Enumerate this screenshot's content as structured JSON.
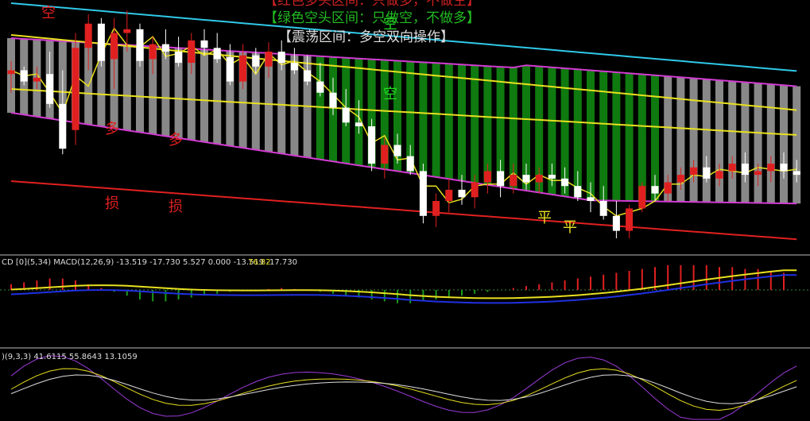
{
  "banner": {
    "red": "【红色多头区间：只做多，不做空】",
    "green": "【绿色空头区间：只做空，不做多】",
    "gray": "【震荡区间：多空双向操作】"
  },
  "signals": {
    "kong": "空",
    "duo": "多",
    "sun": "损",
    "ping": "平"
  },
  "macd_header": {
    "label": "CD [0](5,34)  MACD(12,26,9) -13.519 -17.730 5.527 0.000 -13.519 -17.730",
    "extra": "76.82"
  },
  "kdj_header": {
    "label": ")(9,3,3) 41.6115 55.8643 13.1059"
  },
  "colors": {
    "bull_band": "#888888",
    "bear_band": "#0f7a0f",
    "envelope": "#d23cd2",
    "ma_yellow": "#e8e020",
    "ma_cyan": "#30c8e8",
    "long_red": "#e02020",
    "candle_up": "#e02020",
    "candle_down": "#ffffff",
    "macd_up": "#e02020",
    "macd_down": "#1a9a1a"
  },
  "chart_data": {
    "type": "candlestick",
    "candles": [
      [
        88,
        95,
        78,
        90
      ],
      [
        90,
        92,
        82,
        84
      ],
      [
        84,
        92,
        80,
        86
      ],
      [
        88,
        100,
        70,
        72
      ],
      [
        72,
        90,
        45,
        48
      ],
      [
        58,
        110,
        50,
        102
      ],
      [
        102,
        120,
        90,
        115
      ],
      [
        115,
        118,
        92,
        95
      ],
      [
        96,
        118,
        80,
        110
      ],
      [
        110,
        122,
        100,
        112
      ],
      [
        112,
        115,
        92,
        95
      ],
      [
        96,
        108,
        88,
        104
      ],
      [
        104,
        112,
        96,
        100
      ],
      [
        100,
        108,
        92,
        94
      ],
      [
        94,
        110,
        88,
        106
      ],
      [
        106,
        112,
        98,
        102
      ],
      [
        102,
        110,
        94,
        96
      ],
      [
        97,
        104,
        82,
        84
      ],
      [
        84,
        104,
        80,
        98
      ],
      [
        98,
        102,
        88,
        92
      ],
      [
        92,
        105,
        86,
        100
      ],
      [
        100,
        106,
        90,
        94
      ],
      [
        94,
        102,
        88,
        90
      ],
      [
        90,
        98,
        82,
        84
      ],
      [
        84,
        94,
        76,
        78
      ],
      [
        78,
        86,
        66,
        70
      ],
      [
        70,
        80,
        60,
        62
      ],
      [
        62,
        74,
        56,
        60
      ],
      [
        60,
        64,
        36,
        40
      ],
      [
        40,
        54,
        32,
        50
      ],
      [
        50,
        56,
        40,
        44
      ],
      [
        44,
        50,
        34,
        36
      ],
      [
        36,
        40,
        8,
        12
      ],
      [
        12,
        24,
        6,
        20
      ],
      [
        20,
        32,
        14,
        26
      ],
      [
        26,
        34,
        18,
        22
      ],
      [
        22,
        34,
        16,
        30
      ],
      [
        30,
        40,
        24,
        36
      ],
      [
        36,
        42,
        22,
        28
      ],
      [
        28,
        40,
        24,
        34
      ],
      [
        34,
        40,
        26,
        30
      ],
      [
        30,
        38,
        24,
        34
      ],
      [
        34,
        40,
        28,
        32
      ],
      [
        32,
        38,
        24,
        28
      ],
      [
        28,
        36,
        20,
        22
      ],
      [
        22,
        30,
        14,
        20
      ],
      [
        20,
        28,
        10,
        12
      ],
      [
        12,
        20,
        0,
        4
      ],
      [
        4,
        18,
        0,
        16
      ],
      [
        16,
        30,
        14,
        28
      ],
      [
        28,
        34,
        20,
        24
      ],
      [
        24,
        34,
        20,
        30
      ],
      [
        30,
        38,
        26,
        34
      ],
      [
        34,
        42,
        30,
        38
      ],
      [
        38,
        44,
        30,
        32
      ],
      [
        32,
        40,
        28,
        36
      ],
      [
        36,
        44,
        32,
        40
      ],
      [
        40,
        46,
        30,
        34
      ],
      [
        34,
        40,
        28,
        36
      ],
      [
        36,
        44,
        30,
        40
      ],
      [
        40,
        46,
        32,
        36
      ],
      [
        36,
        42,
        30,
        34
      ]
    ],
    "bands": [
      "bull",
      "bull",
      "bull",
      "bull",
      "bull",
      "bull",
      "bull",
      "bull",
      "bull",
      "bull",
      "bull",
      "bull",
      "bull",
      "bull",
      "bull",
      "bull",
      "bull",
      "bull",
      "bull",
      "bull",
      "bull",
      "bull",
      "bull",
      "bull",
      "bear",
      "bear",
      "bear",
      "bear",
      "bear",
      "bear",
      "bear",
      "bear",
      "bear",
      "bear",
      "bear",
      "bear",
      "bear",
      "bear",
      "bear",
      "bear",
      "bear",
      "bear",
      "bear",
      "bear",
      "bear",
      "bear",
      "bear",
      "bear",
      "bear",
      "bear",
      "bear",
      "bull",
      "bull",
      "bull",
      "bull",
      "bull",
      "bull",
      "bull",
      "bull",
      "bull",
      "bull",
      "bull"
    ],
    "macd_hist": [
      6,
      8,
      10,
      12,
      12,
      10,
      6,
      2,
      -2,
      -6,
      -10,
      -12,
      -12,
      -10,
      -8,
      -6,
      -4,
      -2,
      -1,
      0,
      1,
      2,
      1,
      0,
      -2,
      -4,
      -6,
      -8,
      -10,
      -12,
      -14,
      -14,
      -12,
      -10,
      -8,
      -6,
      -4,
      -2,
      0,
      2,
      4,
      6,
      8,
      10,
      12,
      14,
      16,
      18,
      20,
      22,
      24,
      26,
      26,
      26,
      26,
      24,
      24,
      22,
      22,
      20,
      18
    ]
  }
}
